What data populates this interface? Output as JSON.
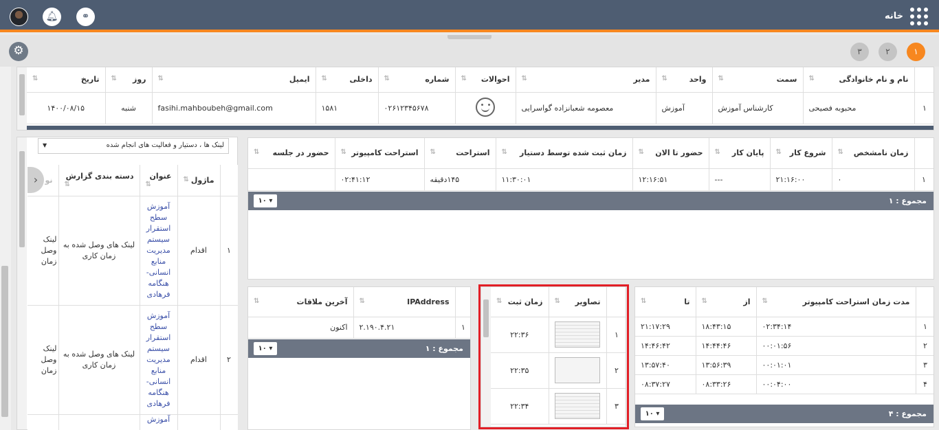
{
  "header": {
    "home_label": "خانه",
    "link_icon": "link-icon",
    "bell_icon": "bell-icon",
    "apps_icon": "apps-grid-icon"
  },
  "tabs": {
    "items": [
      "۱",
      "۲",
      "۳"
    ],
    "settings_icon": "gear-icon"
  },
  "colors": {
    "header": "#4e5d72",
    "accent": "#f7871f",
    "bar": "#6c7584",
    "highlight": "#e21e26"
  },
  "employee": {
    "columns": [
      "نام و نام خانوادگی",
      "سمت",
      "واحد",
      "مدیر",
      "احوالات",
      "شماره",
      "داخلی",
      "ایمیل",
      "روز",
      "تاریخ"
    ],
    "row": {
      "index": "۱",
      "name": "محبوبه فصیحی",
      "position": "کارشناس آموزش",
      "unit": "آموزش",
      "manager": "معصومه شعبانزاده گواسرایی",
      "mood_icon": "smiley-icon",
      "phone": "۰۲۶۱۲۳۴۵۶۷۸",
      "ext": "۱۵۸۱",
      "email": "fasihi.mahboubeh@gmail.com",
      "day": "شنبه",
      "date": "۱۴۰۰/۰۸/۱۵"
    }
  },
  "attendance": {
    "columns": [
      "زمان نامشخص",
      "شروع کار",
      "پایان کار",
      "حضور تا الان",
      "زمان ثبت شده توسط دستیار",
      "استراحت",
      "استراحت کامپیوتر",
      "حضور در جلسه"
    ],
    "row": {
      "index": "۱",
      "unknown": "۰",
      "start": "۲۱:۱۶:۰۰",
      "end": "---",
      "present": "۱۲:۱۶:۵۱",
      "assistant": "۱۱:۳۰:۰۱",
      "rest": "۱۴۵دقیقه",
      "pc_rest": "۰۲:۴۱:۱۲",
      "meeting": ""
    },
    "total": "مجموع : ۱",
    "page_size": "۱۰"
  },
  "reports": {
    "filter": "لینک ها ، دستیار و فعالیت های انجام شده",
    "columns": [
      "ماژول",
      "عنوان",
      "دسته بندی گزارش",
      "نو"
    ],
    "rows": [
      {
        "index": "۱",
        "module": "اقدام",
        "title": "آموزش سطح استقرار سیستم مدیریت منابع انسانی- هنگامه فرهادی",
        "category": "لینک های وصل شده به زمان کاری",
        "extra": "لینک وصل زمان"
      },
      {
        "index": "۲",
        "module": "اقدام",
        "title": "آموزش سطح استقرار سیستم مدیریت منابع انسانی- هنگامه فرهادی",
        "category": "لینک های وصل شده به زمان کاری",
        "extra": "لینک وصل زمان"
      },
      {
        "index": "",
        "module": "",
        "title": "آموزش",
        "category": "",
        "extra": ""
      }
    ]
  },
  "ip": {
    "columns": [
      "IPAddress",
      "آخرین ملاقات"
    ],
    "row": {
      "index": "۱",
      "ip": "۲.۱۹۰.۴.۲۱",
      "last": "اکنون"
    },
    "total": "مجموع : ۱",
    "page_size": "۱۰"
  },
  "shots": {
    "columns": [
      "تصاویر",
      "زمان ثبت"
    ],
    "rows": [
      {
        "index": "۱",
        "time": "۲۲:۳۶"
      },
      {
        "index": "۲",
        "time": "۲۲:۳۵"
      },
      {
        "index": "۳",
        "time": "۲۲:۳۴"
      }
    ]
  },
  "pcbreak": {
    "columns": [
      "مدت زمان استراحت کامپیوتر",
      "از",
      "تا"
    ],
    "rows": [
      {
        "index": "۱",
        "dur": "۰۲:۳۴:۱۴",
        "from": "۱۸:۴۳:۱۵",
        "to": "۲۱:۱۷:۲۹"
      },
      {
        "index": "۲",
        "dur": "۰۰:۰۱:۵۶",
        "from": "۱۴:۴۴:۴۶",
        "to": "۱۴:۴۶:۴۲"
      },
      {
        "index": "۳",
        "dur": "۰۰:۰۱:۰۱",
        "from": "۱۳:۵۶:۳۹",
        "to": "۱۳:۵۷:۴۰"
      },
      {
        "index": "۴",
        "dur": "۰۰:۰۴:۰۰",
        "from": "۰۸:۳۳:۲۶",
        "to": "۰۸:۳۷:۲۷"
      }
    ],
    "total": "مجموع : ۴",
    "page_size": "۱۰"
  }
}
